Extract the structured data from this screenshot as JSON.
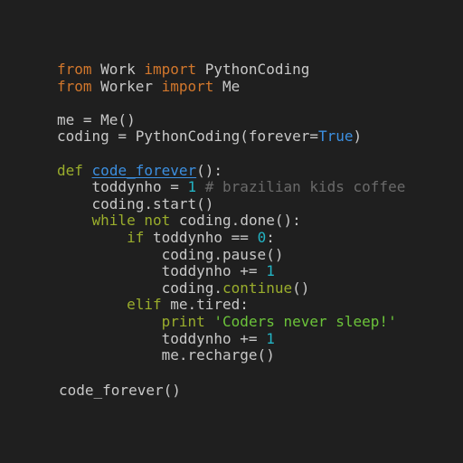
{
  "colors": {
    "background": "#1f1f1f",
    "default": "#c8c8c8",
    "keyword_orange": "#d2772c",
    "keyword_green": "#9aad2c",
    "function_blue": "#3c8fe0",
    "number_cyan": "#23b4c4",
    "string_green": "#6cc43a",
    "comment_gray": "#6a6a6a"
  },
  "code": {
    "lines": [
      [
        {
          "text": "from",
          "color": "#d2772c"
        },
        {
          "text": " Work ",
          "color": "#c8c8c8"
        },
        {
          "text": "import",
          "color": "#d2772c"
        },
        {
          "text": " PythonCoding",
          "color": "#c8c8c8"
        }
      ],
      [
        {
          "text": "from",
          "color": "#d2772c"
        },
        {
          "text": " Worker ",
          "color": "#c8c8c8"
        },
        {
          "text": "import",
          "color": "#d2772c"
        },
        {
          "text": " Me",
          "color": "#c8c8c8"
        }
      ],
      [],
      [
        {
          "text": "me = Me()",
          "color": "#c8c8c8"
        }
      ],
      [
        {
          "text": "coding = PythonCoding(forever=",
          "color": "#c8c8c8"
        },
        {
          "text": "True",
          "color": "#3c8fe0"
        },
        {
          "text": ")",
          "color": "#c8c8c8"
        }
      ],
      [],
      [
        {
          "text": "def",
          "color": "#9aad2c"
        },
        {
          "text": " ",
          "color": "#c8c8c8"
        },
        {
          "text": "code_forever",
          "color": "#3c8fe0",
          "underline": true
        },
        {
          "text": "():",
          "color": "#c8c8c8"
        }
      ],
      [
        {
          "text": "    toddynho = ",
          "color": "#c8c8c8"
        },
        {
          "text": "1",
          "color": "#23b4c4"
        },
        {
          "text": " # brazilian kids coffee",
          "color": "#6a6a6a"
        }
      ],
      [
        {
          "text": "    coding.start()",
          "color": "#c8c8c8"
        }
      ],
      [
        {
          "text": "    ",
          "color": "#c8c8c8"
        },
        {
          "text": "while",
          "color": "#9aad2c"
        },
        {
          "text": " ",
          "color": "#c8c8c8"
        },
        {
          "text": "not",
          "color": "#9aad2c"
        },
        {
          "text": " coding.done():",
          "color": "#c8c8c8"
        }
      ],
      [
        {
          "text": "        ",
          "color": "#c8c8c8"
        },
        {
          "text": "if",
          "color": "#9aad2c"
        },
        {
          "text": " toddynho == ",
          "color": "#c8c8c8"
        },
        {
          "text": "0",
          "color": "#23b4c4"
        },
        {
          "text": ":",
          "color": "#c8c8c8"
        }
      ],
      [
        {
          "text": "            coding.pause()",
          "color": "#c8c8c8"
        }
      ],
      [
        {
          "text": "            toddynho += ",
          "color": "#c8c8c8"
        },
        {
          "text": "1",
          "color": "#23b4c4"
        }
      ],
      [
        {
          "text": "            coding.",
          "color": "#c8c8c8"
        },
        {
          "text": "continue",
          "color": "#9aad2c"
        },
        {
          "text": "()",
          "color": "#c8c8c8"
        }
      ],
      [
        {
          "text": "        ",
          "color": "#c8c8c8"
        },
        {
          "text": "elif",
          "color": "#9aad2c"
        },
        {
          "text": " me.tired:",
          "color": "#c8c8c8"
        }
      ],
      [
        {
          "text": "            ",
          "color": "#c8c8c8"
        },
        {
          "text": "print",
          "color": "#9aad2c"
        },
        {
          "text": " ",
          "color": "#c8c8c8"
        },
        {
          "text": "'Coders never sleep!'",
          "color": "#6cc43a"
        }
      ],
      [
        {
          "text": "            toddynho += ",
          "color": "#c8c8c8"
        },
        {
          "text": "1",
          "color": "#23b4c4"
        }
      ],
      [
        {
          "text": "            me.recharge()",
          "color": "#c8c8c8"
        }
      ],
      [],
      [
        {
          "text": "code_forever()",
          "color": "#c8c8c8"
        }
      ]
    ]
  }
}
